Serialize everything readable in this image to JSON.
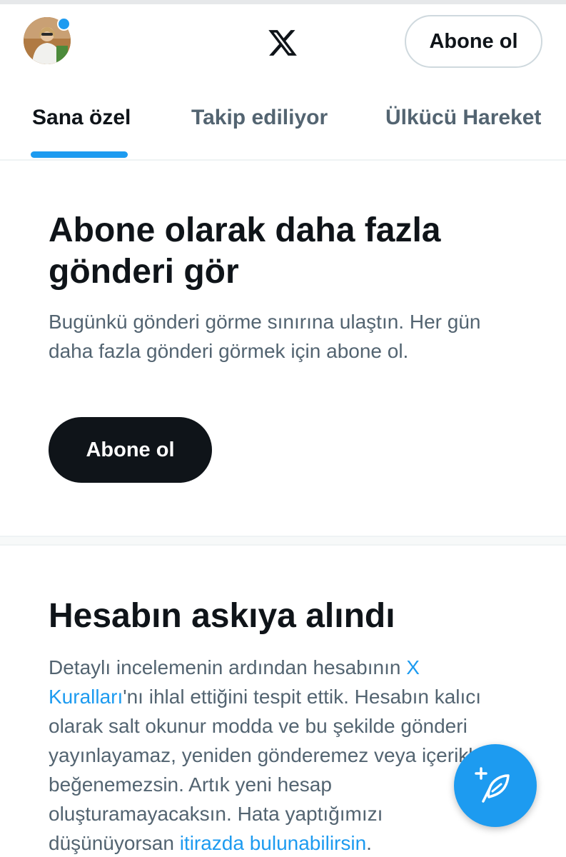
{
  "header": {
    "subscribe_label": "Abone ol",
    "logo_icon": "x-logo-icon",
    "avatar_icon": "profile-avatar",
    "notification_dot_color": "#1d9bf0"
  },
  "tabs": [
    {
      "label": "Sana özel",
      "active": true
    },
    {
      "label": "Takip ediliyor",
      "active": false
    },
    {
      "label": "Ülkücü Hareket",
      "active": false
    }
  ],
  "subscribe_prompt": {
    "title": "Abone olarak daha fazla gönderi gör",
    "body": "Bugünkü gönderi görme sınırına ulaştın. Her gün daha fazla gönderi görmek için abone ol.",
    "button_label": "Abone ol"
  },
  "suspension_notice": {
    "title": "Hesabın askıya alındı",
    "body_part1": "Detaylı incelemenin ardından hesabının ",
    "rules_link": "X Kuralları",
    "body_part2": "'nı ihlal ettiğini tespit ettik. Hesabın kalıcı olarak salt okunur modda ve bu şekilde gönderi yayınlayamaz, yeniden gönderemez veya içerikleri beğenemezsin. Artık yeni hesap oluşturamayacaksın. Hata yaptığımızı düşünüyorsan ",
    "appeal_link": "itirazda bulunabilirsin",
    "body_part3": "."
  },
  "compose_button": {
    "icon": "compose-feather-plus-icon"
  },
  "colors": {
    "accent": "#1d9bf0",
    "text_primary": "#0f1419",
    "text_secondary": "#536471",
    "dark_button": "#0f1419"
  }
}
